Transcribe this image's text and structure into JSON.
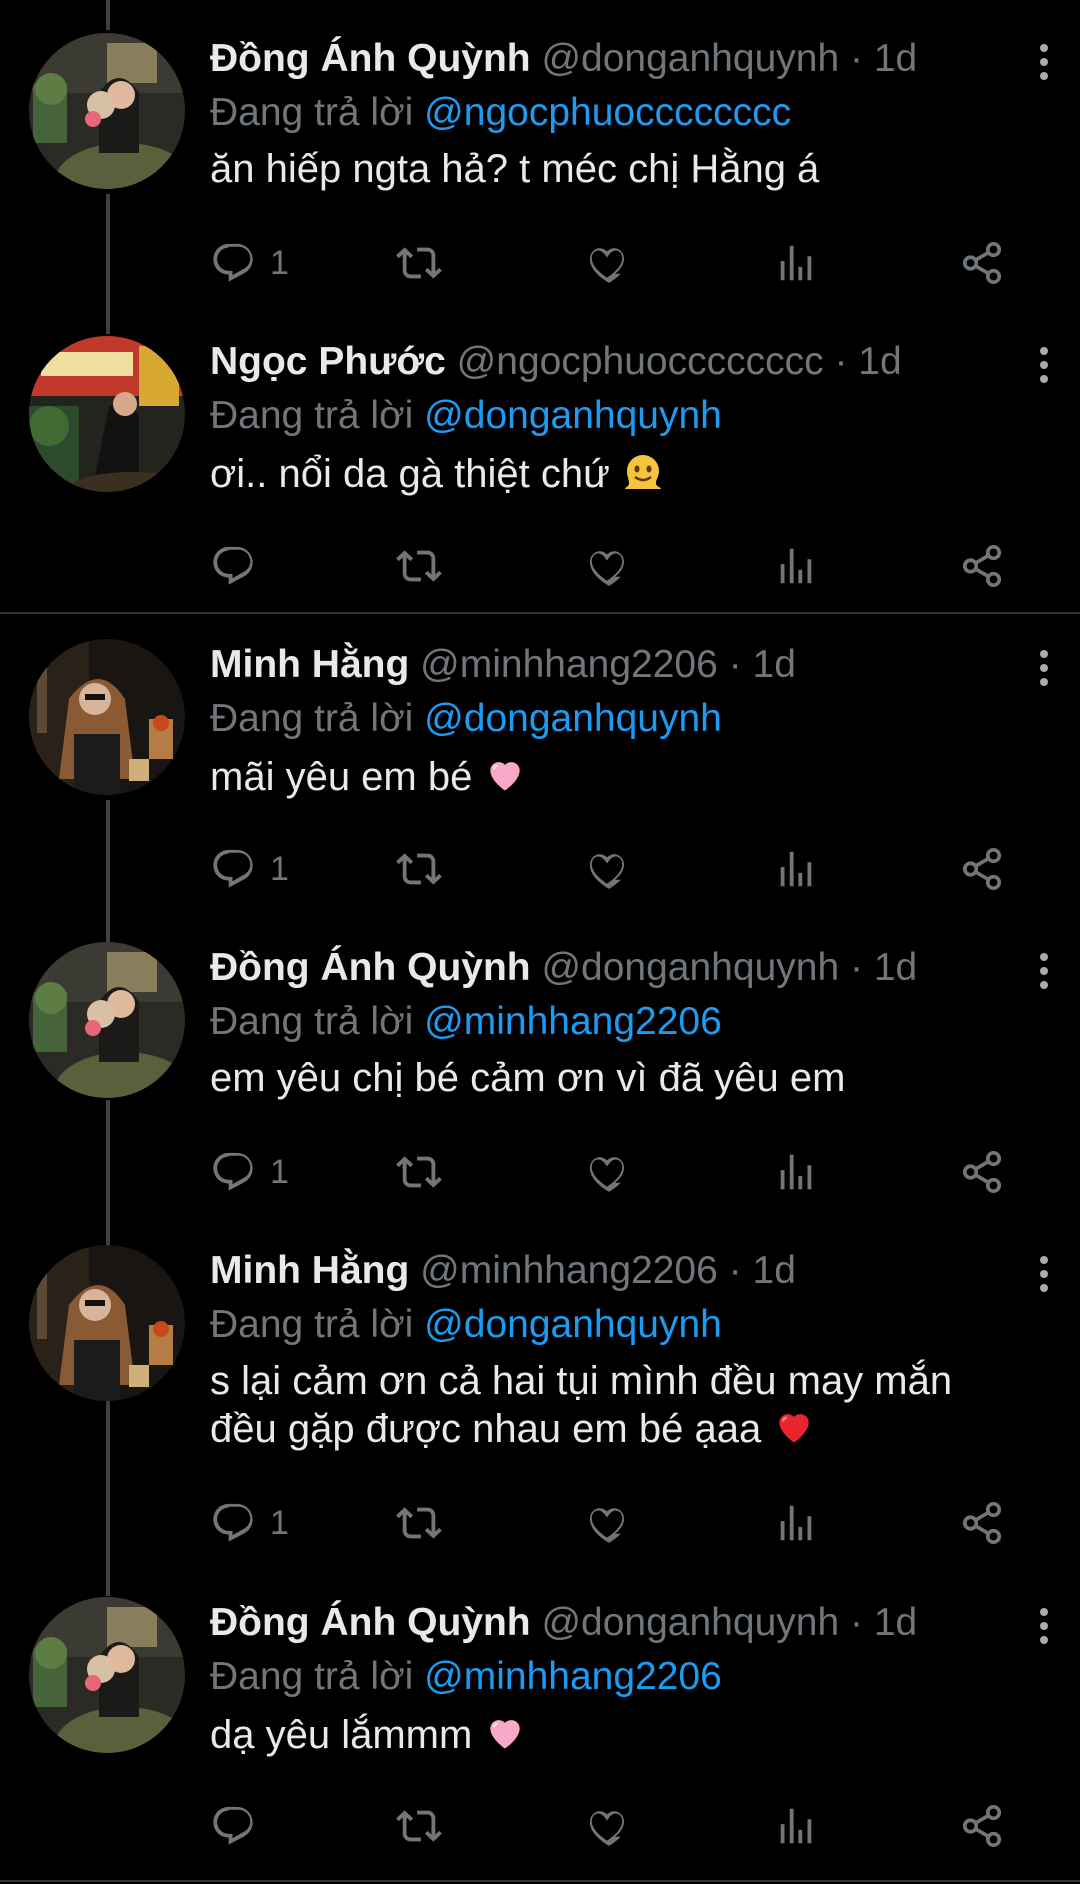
{
  "thread": {
    "reply_prefix": "Đang trả lời",
    "separator": "·"
  },
  "icons": {
    "reply": "reply-icon",
    "retweet": "retweet-icon",
    "like": "heart-icon",
    "views": "analytics-icon",
    "share": "share-icon",
    "more": "more-vertical-icon"
  },
  "colors": {
    "background": "#000000",
    "text": "#e7e9ea",
    "muted": "#71767b",
    "link": "#1d9bf0",
    "thread_line": "#3e4144"
  },
  "tweets": [
    {
      "name": "Đồng Ánh Quỳnh",
      "handle": "@donganhquynh",
      "time": "1d",
      "replying_to": "@ngocphuocccccccc",
      "text": "ăn hiếp ngta hả? t méc chị Hằng á",
      "reply_count": "1"
    },
    {
      "name": "Ngọc Phước",
      "handle": "@ngocphuocccccccc",
      "time": "1d",
      "replying_to": "@donganhquynh",
      "text": "ơi.. nổi da gà thiệt chứ",
      "emoji": "melting-face",
      "reply_count": ""
    },
    {
      "name": "Minh Hằng",
      "handle": "@minhhang2206",
      "time": "1d",
      "replying_to": "@donganhquynh",
      "text": "mãi yêu em bé",
      "emoji": "pink-heart",
      "reply_count": "1"
    },
    {
      "name": "Đồng Ánh Quỳnh",
      "handle": "@donganhquynh",
      "time": "1d",
      "replying_to": "@minhhang2206",
      "text": "em yêu chị bé cảm ơn vì đã yêu em",
      "reply_count": "1"
    },
    {
      "name": "Minh Hằng",
      "handle": "@minhhang2206",
      "time": "1d",
      "replying_to": "@donganhquynh",
      "text_line1": "s lại cảm ơn cả hai tụi mình đều may mắn",
      "text_line2": "đều gặp được nhau em bé ạaa",
      "emoji": "red-heart",
      "reply_count": "1"
    },
    {
      "name": "Đồng Ánh Quỳnh",
      "handle": "@donganhquynh",
      "time": "1d",
      "replying_to": "@minhhang2206",
      "text": "dạ yêu lắmmm",
      "emoji": "pink-heart",
      "reply_count": ""
    }
  ]
}
